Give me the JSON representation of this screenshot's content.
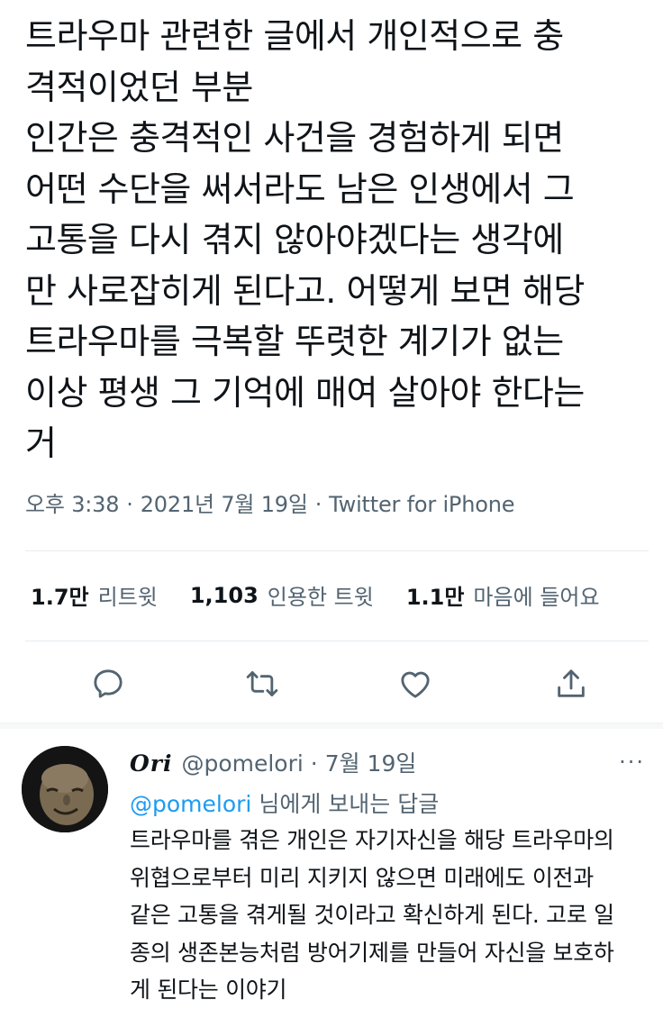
{
  "tweet": {
    "text": "트라우마 관련한 글에서 개인적으로 충\n격적이었던 부분\n인간은 충격적인 사건을 경험하게 되면\n어떤 수단을 써서라도 남은 인생에서 그\n고통을 다시 겪지 않아야겠다는 생각에\n만 사로잡히게 된다고. 어떻게 보면 해당\n트라우마를 극복할 뚜렷한 계기가 없는\n이상 평생 그 기억에 매여 살아야 한다는\n거",
    "time": "오후 3:38",
    "date": "2021년 7월 19일",
    "source": "Twitter for iPhone",
    "separator": "·"
  },
  "stats": {
    "retweets_count": "1.7만",
    "retweets_label": "리트윗",
    "quotes_count": "1,103",
    "quotes_label": "인용한 트윗",
    "likes_count": "1.1만",
    "likes_label": "마음에 들어요"
  },
  "actions": [
    "reply-icon",
    "retweet-icon",
    "like-icon",
    "share-icon"
  ],
  "colors": {
    "link": "#1d9bf0",
    "secondary": "#536471",
    "text": "#0f1419"
  },
  "reply": {
    "name": "Ori",
    "handle": "@pomelori",
    "date": "7월 19일",
    "separator": "·",
    "more": "···",
    "replying_to_handle": "@pomelori",
    "replying_to_suffix": "님에게 보내는 답글",
    "text": "트라우마를 겪은 개인은 자기자신을 해당 트라우마의\n위협으로부터 미리 지키지 않으면 미래에도 이전과\n같은 고통을 겪게될 것이라고 확신하게 된다. 고로 일\n종의 생존본능처럼 방어기제를 만들어 자신을 보호하\n게 된다는 이야기"
  }
}
